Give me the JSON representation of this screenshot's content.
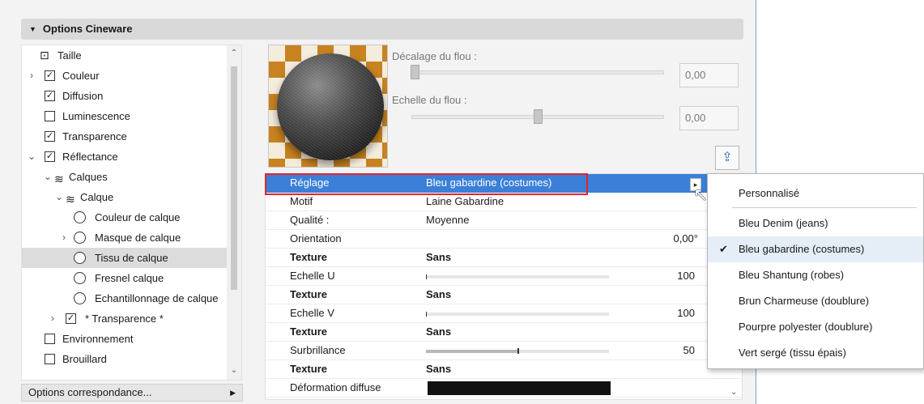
{
  "section": {
    "title": "Options Cineware"
  },
  "tree": {
    "items": [
      {
        "label": "Taille",
        "icon": "size-icon",
        "checkbox": null,
        "expand": null,
        "indent": 0
      },
      {
        "label": "Couleur",
        "checkbox": true,
        "expand": "collapsed",
        "indent": 0
      },
      {
        "label": "Diffusion",
        "checkbox": true,
        "expand": null,
        "indent": 0
      },
      {
        "label": "Luminescence",
        "checkbox": false,
        "expand": null,
        "indent": 0
      },
      {
        "label": "Transparence",
        "checkbox": true,
        "expand": null,
        "indent": 0
      },
      {
        "label": "Réflectance",
        "checkbox": true,
        "expand": "expanded",
        "indent": 0
      },
      {
        "label": "Calques",
        "icon": "layers-icon",
        "expand": "expanded",
        "indent": 1
      },
      {
        "label": "Calque",
        "icon": "layers-icon",
        "expand": "expanded",
        "indent": 2
      },
      {
        "label": "Couleur de calque",
        "radio": true,
        "indent": 3
      },
      {
        "label": "Masque de calque",
        "radio": true,
        "expand": "collapsed",
        "indent": 3
      },
      {
        "label": "Tissu de calque",
        "radio": true,
        "indent": 3,
        "selected": true
      },
      {
        "label": "Fresnel calque",
        "radio": true,
        "indent": 3
      },
      {
        "label": "Echantillonnage de calque",
        "radio": true,
        "indent": 3
      },
      {
        "label": "* Transparence *",
        "checkbox": true,
        "expand": "collapsed",
        "indent": 1
      },
      {
        "label": "Environnement",
        "checkbox": false,
        "indent": 0
      },
      {
        "label": "Brouillard",
        "checkbox": false,
        "indent": 0
      }
    ]
  },
  "options_button": {
    "label": "Options correspondance..."
  },
  "blur": {
    "offset_label": "Décalage du flou :",
    "offset_value": "0,00",
    "offset_level": 0.0,
    "scale_label": "Echelle du flou :",
    "scale_value": "0,00",
    "scale_level": 0.5
  },
  "props": {
    "rows": [
      {
        "key": "Réglage",
        "value": "Bleu gabardine (costumes)",
        "selected": true
      },
      {
        "key": "Motif",
        "value": "Laine Gabardine"
      },
      {
        "key": "Qualité :",
        "value": "Moyenne"
      },
      {
        "key": "Orientation",
        "value": "",
        "num": "0,00°"
      },
      {
        "key": "Texture",
        "value": "Sans",
        "bold": true
      },
      {
        "key": "Echelle U",
        "num": "100",
        "slider": 0
      },
      {
        "key": "Texture",
        "value": "Sans",
        "bold": true
      },
      {
        "key": "Echelle V",
        "num": "100",
        "slider": 0
      },
      {
        "key": "Texture",
        "value": "Sans",
        "bold": true
      },
      {
        "key": "Surbrillance",
        "num": "50",
        "slider": 0.5
      },
      {
        "key": "Texture",
        "value": "Sans",
        "bold": true
      },
      {
        "key": "Déformation diffuse",
        "swatch": "#111111"
      }
    ]
  },
  "menu": {
    "items": [
      {
        "label": "Personnalisé",
        "checked": false
      },
      {
        "label": "Bleu Denim (jeans)",
        "checked": false
      },
      {
        "label": "Bleu gabardine (costumes)",
        "checked": true
      },
      {
        "label": "Bleu Shantung (robes)",
        "checked": false
      },
      {
        "label": "Brun Charmeuse (doublure)",
        "checked": false
      },
      {
        "label": "Pourpre polyester (doublure)",
        "checked": false
      },
      {
        "label": "Vert sergé (tissu épais)",
        "checked": false
      }
    ]
  },
  "colors": {
    "selection": "#3b7fd8",
    "highlight_frame": "#e8222a"
  }
}
